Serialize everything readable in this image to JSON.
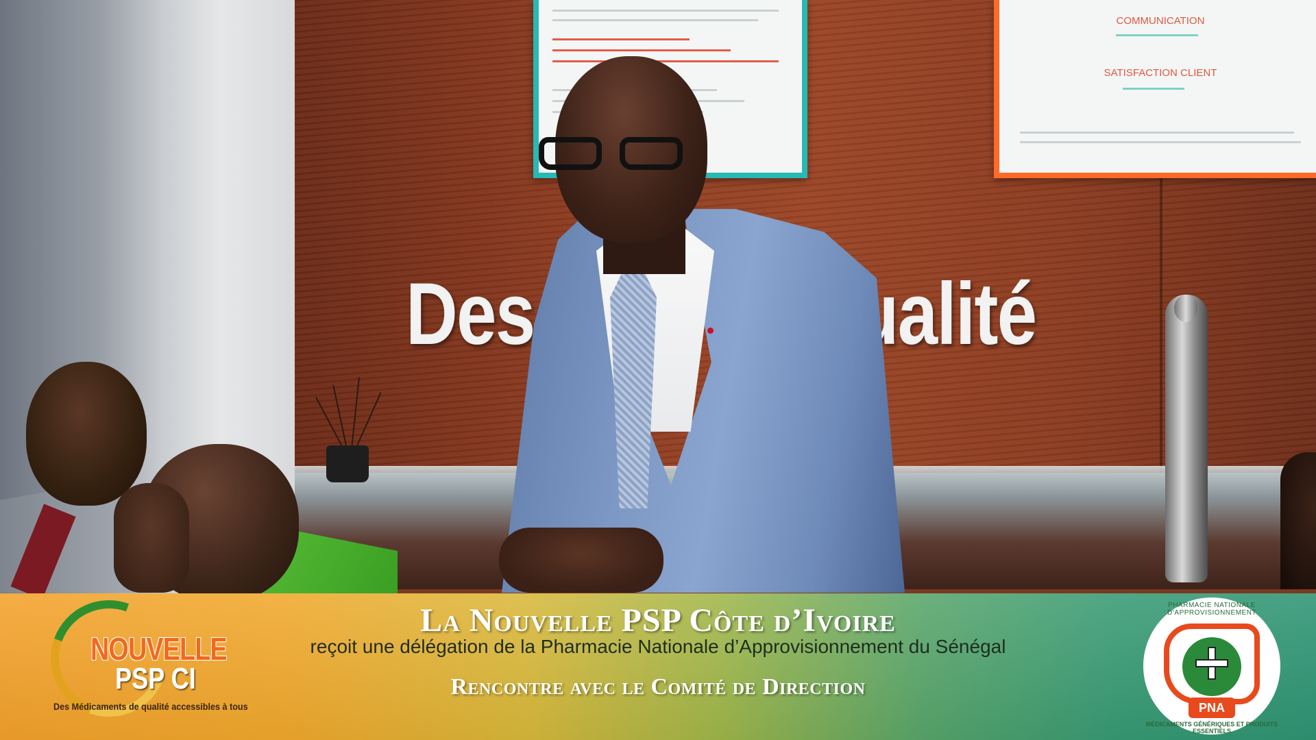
{
  "wall": {
    "slogan": "Des M        ts de qualité"
  },
  "posters": {
    "right": {
      "heading1": "COMMUNICATION",
      "heading2": "SATISFACTION CLIENT"
    }
  },
  "banner": {
    "title": "La Nouvelle PSP Côte d’Ivoire",
    "subtitle": "reçoit une délégation de la Pharmacie Nationale d’Approvisionnement du Sénégal",
    "subtitle2": "Rencontre avec le Comité de Direction"
  },
  "logo_left": {
    "word1": "NOUVELLE",
    "word2": "PSP CI",
    "tagline": "Des Médicaments de qualité accessibles à tous"
  },
  "logo_right": {
    "abbr": "PNA",
    "arc_top": "PHARMACIE NATIONALE D’APPROVISIONNEMENT",
    "arc_bottom": "MÉDICAMENTS GÉNÉRIQUES ET PRODUITS ESSENTIELS"
  },
  "colors": {
    "banner_left": "#f3a12b",
    "banner_right": "#2e9473",
    "suit": "#7d98c4",
    "logo_orange": "#f06a1c",
    "pna_red": "#e84a1e",
    "pna_green": "#2a8a3a"
  }
}
